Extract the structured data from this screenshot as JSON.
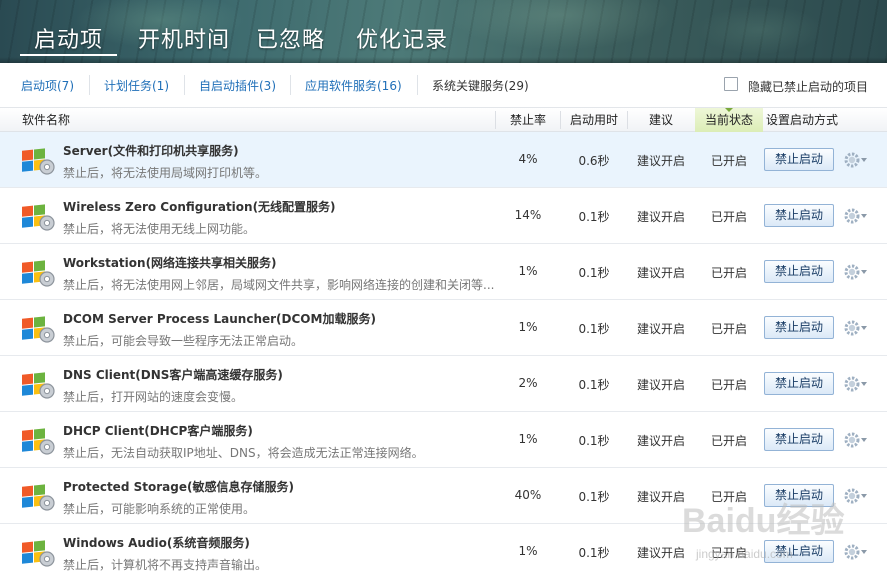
{
  "main_tabs": [
    {
      "label": "启动项",
      "active": true
    },
    {
      "label": "开机时间",
      "active": false
    },
    {
      "label": "已忽略",
      "active": false
    },
    {
      "label": "优化记录",
      "active": false
    }
  ],
  "sub_tabs": [
    {
      "label": "启动项(7)"
    },
    {
      "label": "计划任务(1)"
    },
    {
      "label": "自启动插件(3)"
    },
    {
      "label": "应用软件服务(16)"
    },
    {
      "label": "系统关键服务(29)"
    }
  ],
  "hide_disabled": {
    "label": "隐藏已禁止启动的项目",
    "checked": false
  },
  "columns": {
    "name": "软件名称",
    "disable_rate": "禁止率",
    "boot_time": "启动用时",
    "suggestion": "建议",
    "status": "当前状态",
    "set_mode": "设置启动方式"
  },
  "rows": [
    {
      "title": "Server(文件和打印机共享服务)",
      "desc": "禁止后，将无法使用局域网打印机等。",
      "rate": "4%",
      "time": "0.6秒",
      "suggestion": "建议开启",
      "status": "已开启",
      "action": "禁止启动"
    },
    {
      "title": "Wireless Zero Configuration(无线配置服务)",
      "desc": "禁止后，将无法使用无线上网功能。",
      "rate": "14%",
      "time": "0.1秒",
      "suggestion": "建议开启",
      "status": "已开启",
      "action": "禁止启动"
    },
    {
      "title": "Workstation(网络连接共享相关服务)",
      "desc": "禁止后，将无法使用网上邻居，局域网文件共享，影响网络连接的创建和关闭等...",
      "rate": "1%",
      "time": "0.1秒",
      "suggestion": "建议开启",
      "status": "已开启",
      "action": "禁止启动"
    },
    {
      "title": "DCOM Server Process Launcher(DCOM加载服务)",
      "desc": "禁止后，可能会导致一些程序无法正常启动。",
      "rate": "1%",
      "time": "0.1秒",
      "suggestion": "建议开启",
      "status": "已开启",
      "action": "禁止启动"
    },
    {
      "title": "DNS Client(DNS客户端高速缓存服务)",
      "desc": "禁止后，打开网站的速度会变慢。",
      "rate": "2%",
      "time": "0.1秒",
      "suggestion": "建议开启",
      "status": "已开启",
      "action": "禁止启动"
    },
    {
      "title": "DHCP Client(DHCP客户端服务)",
      "desc": "禁止后，无法自动获取IP地址、DNS，将会造成无法正常连接网络。",
      "rate": "1%",
      "time": "0.1秒",
      "suggestion": "建议开启",
      "status": "已开启",
      "action": "禁止启动"
    },
    {
      "title": "Protected Storage(敏感信息存储服务)",
      "desc": "禁止后，可能影响系统的正常使用。",
      "rate": "40%",
      "time": "0.1秒",
      "suggestion": "建议开启",
      "status": "已开启",
      "action": "禁止启动"
    },
    {
      "title": "Windows Audio(系统音频服务)",
      "desc": "禁止后，计算机将不再支持声音输出。",
      "rate": "1%",
      "time": "0.1秒",
      "suggestion": "建议开启",
      "status": "已开启",
      "action": "禁止启动"
    }
  ],
  "watermark": {
    "brand": "Baidu经验",
    "url": "jingyan.baidu.com"
  },
  "colors": {
    "link": "#1f6fb8",
    "status_header": "#dcedb6",
    "selected_row": "#eaf4fd",
    "button_border": "#93b3d6"
  }
}
